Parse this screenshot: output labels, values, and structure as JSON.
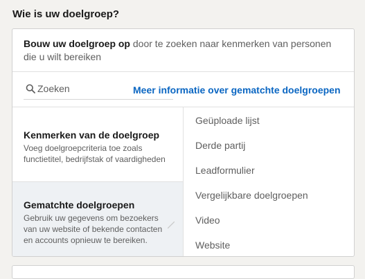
{
  "section": {
    "title": "Wie is uw doelgroep?"
  },
  "intro": {
    "bold": "Bouw uw doelgroep op",
    "rest": " door te zoeken naar kenmerken van personen die u wilt bereiken"
  },
  "search": {
    "placeholder": "Zoeken",
    "value": ""
  },
  "more_link": "Meer informatie over gematchte doelgroepen",
  "options": [
    {
      "title": "Kenmerken van de doelgroep",
      "description": "Voeg doelgroepcriteria toe zoals functietitel, bedrijfstak of vaardigheden"
    },
    {
      "title": "Gematchte doelgroepen",
      "description": "Gebruik uw gegevens om bezoekers van uw website of bekende contacten en accounts opnieuw te bereiken."
    }
  ],
  "submenu": [
    "Geüploade lijst",
    "Derde partij",
    "Leadformulier",
    "Vergelijkbare doelgroepen",
    "Video",
    "Website"
  ],
  "colors": {
    "link": "#0a66c2",
    "selected_bg": "#eef1f4"
  },
  "icons": {
    "search": "search-icon",
    "chevron": "chevron-right-icon"
  }
}
